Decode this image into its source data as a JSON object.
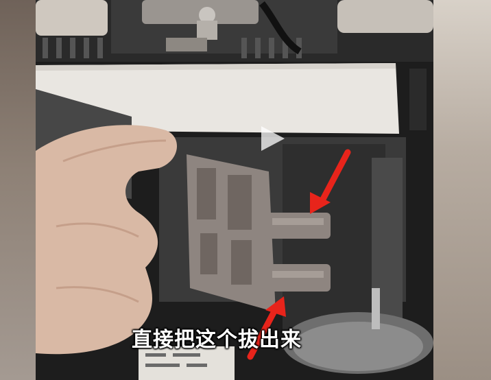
{
  "video": {
    "subtitle": "直接把这个拔出来",
    "play_state": "paused"
  },
  "icons": {
    "play": "play-icon",
    "arrow_top": "red-arrow-icon",
    "arrow_bottom": "red-arrow-icon"
  },
  "colors": {
    "arrow": "#e8241b",
    "subtitle": "#ffffff",
    "subtitle_outline": "#000000"
  }
}
